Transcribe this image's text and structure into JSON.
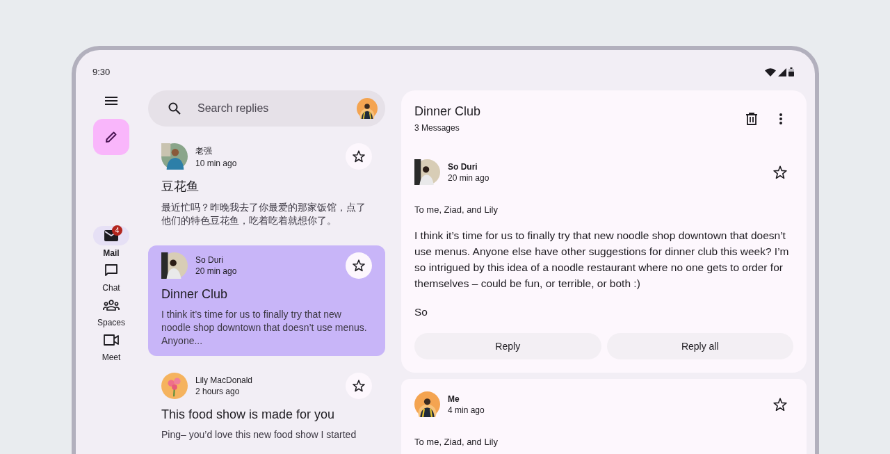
{
  "status_bar": {
    "time": "9:30"
  },
  "nav": {
    "items": [
      {
        "kind": "mail",
        "label": "Mail",
        "selected": true,
        "badge": "4"
      },
      {
        "kind": "chat",
        "label": "Chat",
        "selected": false
      },
      {
        "kind": "spaces",
        "label": "Spaces",
        "selected": false
      },
      {
        "kind": "meet",
        "label": "Meet",
        "selected": false
      }
    ]
  },
  "search": {
    "placeholder": "Search replies"
  },
  "emails": [
    {
      "sender": "老强",
      "time": "10 min ago",
      "subject": "豆花鱼",
      "preview": "最近忙吗？昨晚我去了你最爱的那家饭馆，点了他们的特色豆花鱼，吃着吃着就想你了。",
      "selected": false
    },
    {
      "sender": "So Duri",
      "time": "20 min ago",
      "subject": "Dinner Club",
      "preview": "I think it’s time for us to finally try that new noodle shop downtown that doesn’t use menus. Anyone...",
      "selected": true
    },
    {
      "sender": "Lily MacDonald",
      "time": "2 hours ago",
      "subject": "This food show is made for you",
      "preview": "Ping– you’d love this new food show I started",
      "selected": false
    }
  ],
  "thread": {
    "subject": "Dinner Club",
    "count": "3 Messages",
    "messages": [
      {
        "sender": "So Duri",
        "time": "20 min ago",
        "recipients": "To me, Ziad, and Lily",
        "body": [
          "I think it’s time for us to finally try that new noodle shop downtown that doesn’t use menus. Anyone else have other suggestions for dinner club this week? I’m so intrigued by this idea of a noodle restaurant where no one gets to order for themselves – could be fun, or terrible, or both :)",
          "So"
        ],
        "actions": [
          "Reply",
          "Reply all"
        ]
      },
      {
        "sender": "Me",
        "time": "4 min ago",
        "recipients": "To me, Ziad, and Lily"
      }
    ]
  }
}
